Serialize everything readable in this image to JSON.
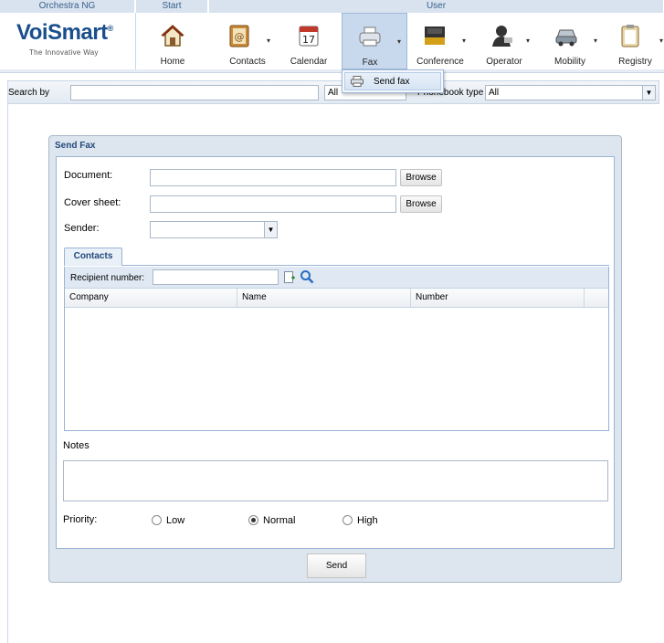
{
  "toolbar": {
    "groups": {
      "brand": "Orchestra NG",
      "start": "Start",
      "user": "User"
    },
    "brand_logo": "VoiSmart",
    "brand_tagline": "The Innovative Way",
    "buttons": {
      "home": "Home",
      "contacts": "Contacts",
      "calendar": "Calendar",
      "calendar_day": "17",
      "fax": "Fax",
      "conference": "Conference",
      "operator": "Operator",
      "mobility": "Mobility",
      "registry": "Registry"
    }
  },
  "fax_menu": {
    "send_fax": "Send fax"
  },
  "search": {
    "label": "Search by",
    "value": "",
    "filter_value": "All",
    "phonebook_label": "Phonebook type",
    "phonebook_value": "All"
  },
  "send_fax": {
    "title": "Send Fax",
    "document_label": "Document:",
    "cover_label": "Cover sheet:",
    "sender_label": "Sender:",
    "browse_label": "Browse",
    "tab_contacts": "Contacts",
    "recipient_label": "Recipient number:",
    "columns": [
      "Company",
      "Name",
      "Number"
    ],
    "notes_label": "Notes",
    "priority_label": "Priority:",
    "priority_options": [
      "Low",
      "Normal",
      "High"
    ],
    "priority_selected": "Normal",
    "send_label": "Send"
  },
  "colors": {
    "accent": "#1a4f8c",
    "panel_bg": "#dde5ee",
    "header_bg": "#d8e3ef"
  }
}
